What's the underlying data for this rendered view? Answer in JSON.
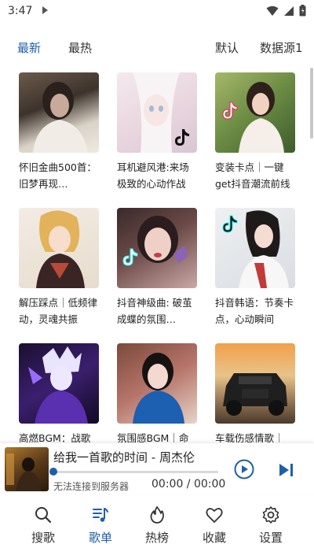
{
  "status_bar": {
    "time": "3:47"
  },
  "filters": {
    "tab_new": "最新",
    "tab_hot": "最热",
    "sort": "默认",
    "source": "数据源1"
  },
  "playlists": [
    {
      "title": "怀旧金曲500首：旧梦再现…"
    },
    {
      "title": "耳机避风港:来场极致的心动作战"
    },
    {
      "title": "变装卡点｜一键get抖音潮流前线"
    },
    {
      "title": "解压踩点｜低频律动，灵魂共振"
    },
    {
      "title": "抖音神级曲: 破茧成蝶的氛围…"
    },
    {
      "title": "抖音韩语：节奏卡点，心动瞬间"
    },
    {
      "title": "高燃BGM：战歌"
    },
    {
      "title": "氛围感BGM｜命"
    },
    {
      "title": "车载伤感情歌｜"
    }
  ],
  "player": {
    "title": "给我一首歌的时间 - 周杰伦",
    "status": "无法连接到服务器",
    "time": "00:00 / 00:00",
    "progress": 0
  },
  "nav": {
    "search": "搜歌",
    "playlist": "歌单",
    "charts": "热榜",
    "favorites": "收藏",
    "settings": "设置"
  },
  "colors": {
    "accent": "#1f5fa8"
  }
}
